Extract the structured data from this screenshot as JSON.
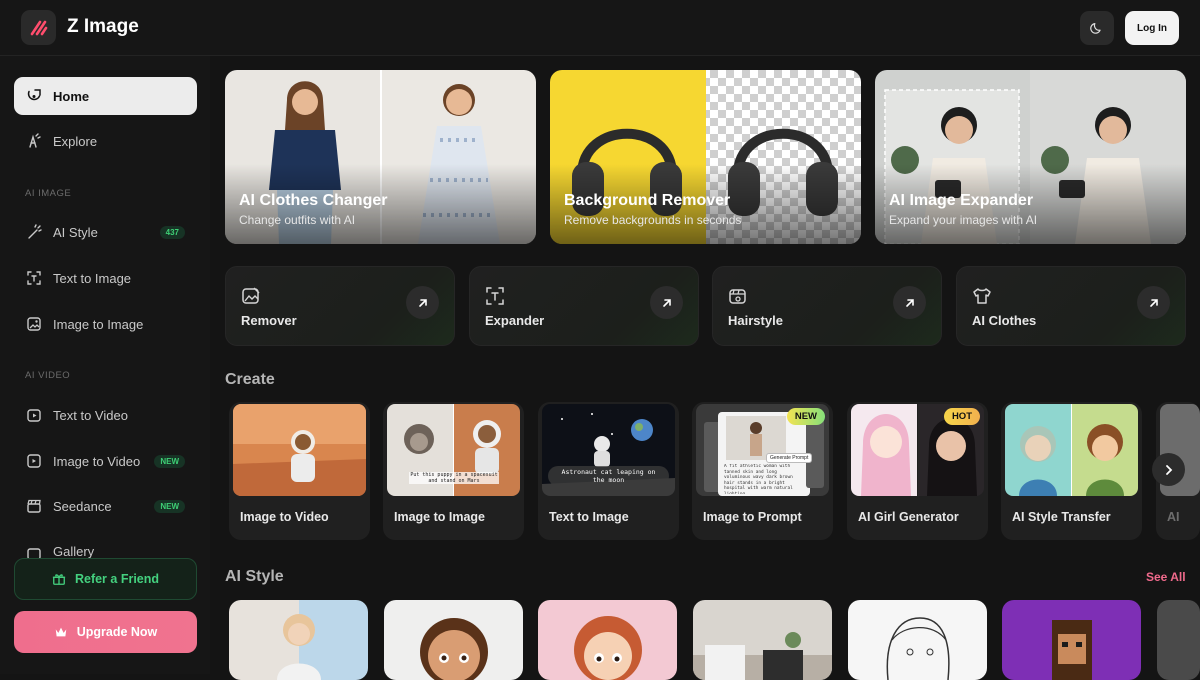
{
  "header": {
    "app_title": "Z Image",
    "logo_icon": "z-logo-icon",
    "theme_icon": "moon-icon",
    "login_label": "Log In"
  },
  "sidebar": {
    "items": [
      {
        "label": "Home",
        "icon": "home-icon",
        "active": true
      },
      {
        "label": "Explore",
        "icon": "compass-icon"
      }
    ],
    "sections": [
      {
        "label": "AI IMAGE",
        "items": [
          {
            "label": "AI Style",
            "icon": "wand-icon",
            "badge": "437"
          },
          {
            "label": "Text to Image",
            "icon": "text-image-icon"
          },
          {
            "label": "Image to Image",
            "icon": "image-icon"
          }
        ]
      },
      {
        "label": "AI VIDEO",
        "items": [
          {
            "label": "Text to Video",
            "icon": "video-text-icon"
          },
          {
            "label": "Image to Video",
            "icon": "video-image-icon",
            "badge": "NEW"
          },
          {
            "label": "Seedance",
            "icon": "clapper-icon",
            "badge": "NEW"
          },
          {
            "label": "Gallery",
            "icon": "gallery-icon"
          }
        ]
      }
    ],
    "refer_label": "Refer a Friend",
    "upgrade_label": "Upgrade Now"
  },
  "features": [
    {
      "title": "AI Clothes Changer",
      "subtitle": "Change outfits with AI"
    },
    {
      "title": "Background Remover",
      "subtitle": "Remove backgrounds in seconds"
    },
    {
      "title": "AI Image Expander",
      "subtitle": "Expand your images with AI"
    }
  ],
  "tools": [
    {
      "label": "Remover",
      "icon": "eraser-icon"
    },
    {
      "label": "Expander",
      "icon": "expand-icon"
    },
    {
      "label": "Hairstyle",
      "icon": "hairstyle-icon"
    },
    {
      "label": "AI Clothes",
      "icon": "shirt-icon"
    }
  ],
  "create": {
    "title": "Create",
    "cards": [
      {
        "label": "Image to Video"
      },
      {
        "label": "Image to Image",
        "caption": "Put this puppy in a spacesuit and stand on Mars"
      },
      {
        "label": "Text to Image",
        "caption": "Astronaut cat leaping on the moon"
      },
      {
        "label": "Image to Prompt",
        "tag": "NEW",
        "caption": "A fit athletic woman with tanned skin and long voluminous wavy dark brown hair stands in a bright hospital with warm natural lighting",
        "button": "Generate Prompt"
      },
      {
        "label": "AI Girl Generator",
        "tag": "HOT"
      },
      {
        "label": "AI Style Transfer"
      },
      {
        "label": "AI"
      }
    ]
  },
  "ai_style": {
    "title": "AI Style",
    "see_all": "See All"
  },
  "colors": {
    "accent_pink": "#f06a8c",
    "accent_green": "#44d17f",
    "bg": "#141414"
  }
}
